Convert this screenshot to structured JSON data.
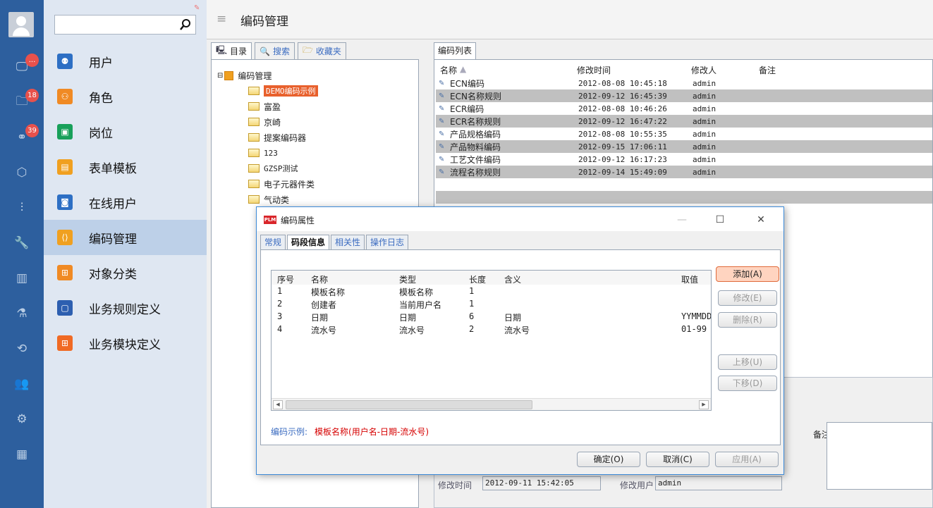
{
  "rail": {
    "badges": [
      "...",
      "18",
      "39"
    ]
  },
  "sidebar": {
    "items": [
      {
        "label": "用户",
        "icon": "user-icon",
        "color": "#2d6fc4"
      },
      {
        "label": "角色",
        "icon": "role-icon",
        "color": "#f08a24"
      },
      {
        "label": "岗位",
        "icon": "position-icon",
        "color": "#18a05a"
      },
      {
        "label": "表单模板",
        "icon": "form-icon",
        "color": "#f0a020"
      },
      {
        "label": "在线用户",
        "icon": "online-icon",
        "color": "#2d6fc4"
      },
      {
        "label": "编码管理",
        "icon": "code-icon",
        "color": "#f0a020"
      },
      {
        "label": "对象分类",
        "icon": "category-icon",
        "color": "#f08a24"
      },
      {
        "label": "业务规则定义",
        "icon": "rule-icon",
        "color": "#2d5fb0"
      },
      {
        "label": "业务模块定义",
        "icon": "module-icon",
        "color": "#f06a24"
      }
    ]
  },
  "title": "编码管理",
  "leftTabs": [
    "目录",
    "搜索",
    "收藏夹"
  ],
  "tree": {
    "root": "编码管理",
    "items": [
      "DEMO编码示例",
      "富盈",
      "京崎",
      "提案编码器",
      "123",
      "GZSP测试",
      "电子元器件类",
      "气动类"
    ]
  },
  "list": {
    "tab": "编码列表",
    "headers": [
      "名称",
      "修改时间",
      "修改人",
      "备注"
    ],
    "rows": [
      [
        "ECN编码",
        "2012-08-08 10:45:18",
        "admin"
      ],
      [
        "ECN名称规则",
        "2012-09-12 16:45:39",
        "admin"
      ],
      [
        "ECR编码",
        "2012-08-08 10:46:26",
        "admin"
      ],
      [
        "ECR名称规则",
        "2012-09-12 16:47:22",
        "admin"
      ],
      [
        "产品规格编码",
        "2012-08-08 10:55:35",
        "admin"
      ],
      [
        "产品物料编码",
        "2012-09-15 17:06:11",
        "admin"
      ],
      [
        "工艺文件编码",
        "2012-09-12 16:17:23",
        "admin"
      ],
      [
        "流程名称规则",
        "2012-09-14 15:49:09",
        "admin"
      ]
    ]
  },
  "detail": {
    "mod_time_label": "修改时间",
    "mod_time": "2012-09-11 15:42:05",
    "mod_user_label": "修改用户",
    "mod_user": "admin",
    "remark_label": "备注"
  },
  "dialog": {
    "title": "编码属性",
    "logo": "PLM",
    "tabs": [
      "常规",
      "码段信息",
      "相关性",
      "操作日志"
    ],
    "headers": [
      "序号",
      "名称",
      "类型",
      "长度",
      "含义",
      "取值"
    ],
    "rows": [
      [
        "1",
        "模板名称",
        "模板名称",
        "1",
        "",
        ""
      ],
      [
        "2",
        "创建者",
        "当前用户名",
        "1",
        "",
        ""
      ],
      [
        "3",
        "日期",
        "日期",
        "6",
        "日期",
        "YYMMDD"
      ],
      [
        "4",
        "流水号",
        "流水号",
        "2",
        "流水号",
        "01-99"
      ]
    ],
    "buttons": {
      "add": "添加(A)",
      "edit": "修改(E)",
      "delete": "删除(R)",
      "up": "上移(U)",
      "down": "下移(D)",
      "ok": "确定(O)",
      "cancel": "取消(C)",
      "apply": "应用(A)"
    },
    "example_label": "编码示例:",
    "example_value": "模板名称(用户名-日期-流水号)"
  }
}
